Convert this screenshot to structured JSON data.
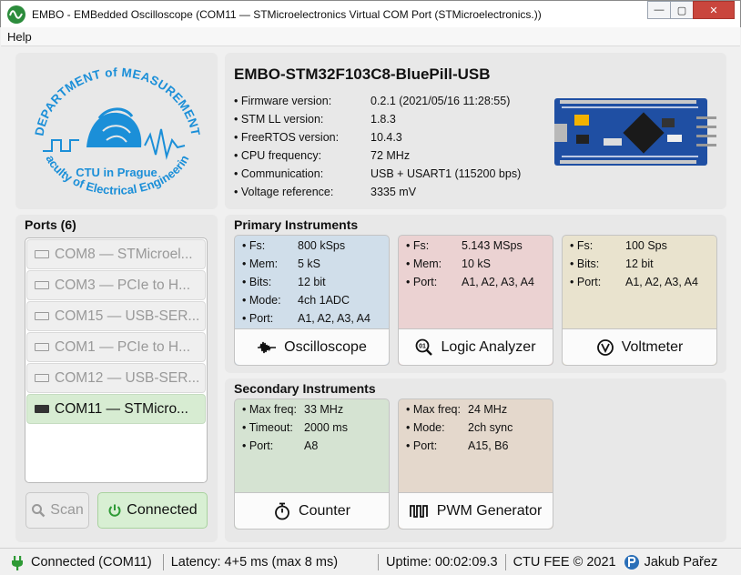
{
  "window": {
    "title": "EMBO - EMBedded Oscilloscope (COM11 — STMicroelectronics Virtual COM Port (STMicroelectronics.))",
    "minimize": "—",
    "maximize": "▢",
    "close": "✕"
  },
  "menu": {
    "help": "Help"
  },
  "logo": {
    "top_text": "DEPARTMENT of MEASUREMENT",
    "middle_text": "CTU in Prague",
    "bottom_text": "Faculty of Electrical Engineering",
    "color": "#1b8fd8"
  },
  "device": {
    "title": "EMBO-STM32F103C8-BluePill-USB",
    "info": [
      {
        "label": "Firmware version:",
        "value": "0.2.1 (2021/05/16 11:28:55)"
      },
      {
        "label": "STM LL version:",
        "value": "1.8.3"
      },
      {
        "label": "FreeRTOS version:",
        "value": "10.4.3"
      },
      {
        "label": "CPU frequency:",
        "value": "72 MHz"
      },
      {
        "label": "Communication:",
        "value": "USB + USART1 (115200 bps)"
      },
      {
        "label": "Voltage reference:",
        "value": "3335 mV"
      }
    ]
  },
  "ports": {
    "title": "Ports (6)",
    "items": [
      {
        "label": "COM8 — STMicroel..."
      },
      {
        "label": "COM3 — PCIe to H..."
      },
      {
        "label": "COM15 — USB-SER..."
      },
      {
        "label": "COM1 — PCIe to H..."
      },
      {
        "label": "COM12 — USB-SER..."
      },
      {
        "label": "COM11 — STMicro..."
      }
    ],
    "scan_label": "Scan",
    "connected_label": "Connected"
  },
  "primary": {
    "title": "Primary Instruments",
    "oscilloscope": {
      "label": "Oscilloscope",
      "color": "#d0deea",
      "params": [
        {
          "label": "Fs:",
          "value": "800 kSps"
        },
        {
          "label": "Mem:",
          "value": "5 kS"
        },
        {
          "label": "Bits:",
          "value": "12 bit"
        },
        {
          "label": "Mode:",
          "value": "4ch 1ADC"
        },
        {
          "label": "Port:",
          "value": "A1, A2, A3, A4"
        }
      ]
    },
    "logic_analyzer": {
      "label": "Logic Analyzer",
      "color": "#ebd2d2",
      "params": [
        {
          "label": "Fs:",
          "value": "5.143 MSps"
        },
        {
          "label": "Mem:",
          "value": "10 kS"
        },
        {
          "label": "Port:",
          "value": "A1, A2, A3, A4"
        }
      ]
    },
    "voltmeter": {
      "label": "Voltmeter",
      "color": "#e9e3ce",
      "params": [
        {
          "label": "Fs:",
          "value": "100 Sps"
        },
        {
          "label": "Bits:",
          "value": "12 bit"
        },
        {
          "label": "Port:",
          "value": "A1, A2, A3, A4"
        }
      ]
    }
  },
  "secondary": {
    "title": "Secondary Instruments",
    "counter": {
      "label": "Counter",
      "color": "#d5e3d2",
      "params": [
        {
          "label": "Max freq:",
          "value": "33 MHz"
        },
        {
          "label": "Timeout:",
          "value": "2000 ms"
        },
        {
          "label": "Port:",
          "value": "A8"
        }
      ]
    },
    "pwm": {
      "label": "PWM Generator",
      "color": "#e4d8cc",
      "params": [
        {
          "label": "Max freq:",
          "value": "24 MHz"
        },
        {
          "label": "Mode:",
          "value": "2ch sync"
        },
        {
          "label": "Port:",
          "value": "A15, B6"
        }
      ]
    }
  },
  "status": {
    "connection": "Connected (COM11)",
    "latency": "Latency: 4+5 ms (max 8 ms)",
    "uptime": "Uptime: 00:02:09.3",
    "copyright": "CTU FEE © 2021",
    "author": "Jakub Pařez"
  }
}
